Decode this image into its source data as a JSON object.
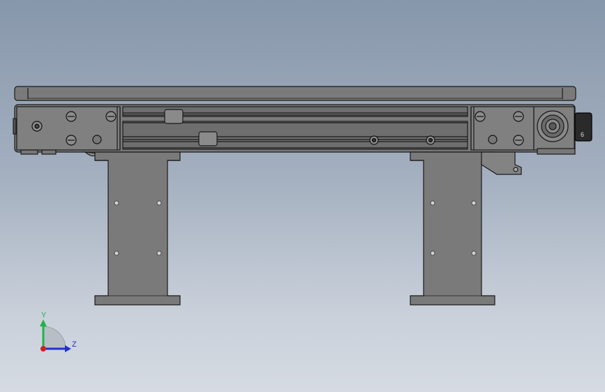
{
  "viewport": {
    "background_top": "#8797ab",
    "background_bottom": "#d6dbe2"
  },
  "model": {
    "part_color": "#7a7a7a",
    "edge_color": "#1a1a1a",
    "rail_color": "#6e6e6e"
  },
  "triad": {
    "y_label": "Y",
    "z_label": "Z",
    "y_color": "#22b34a",
    "z_color": "#2030d0",
    "origin_color": "#d02020"
  }
}
